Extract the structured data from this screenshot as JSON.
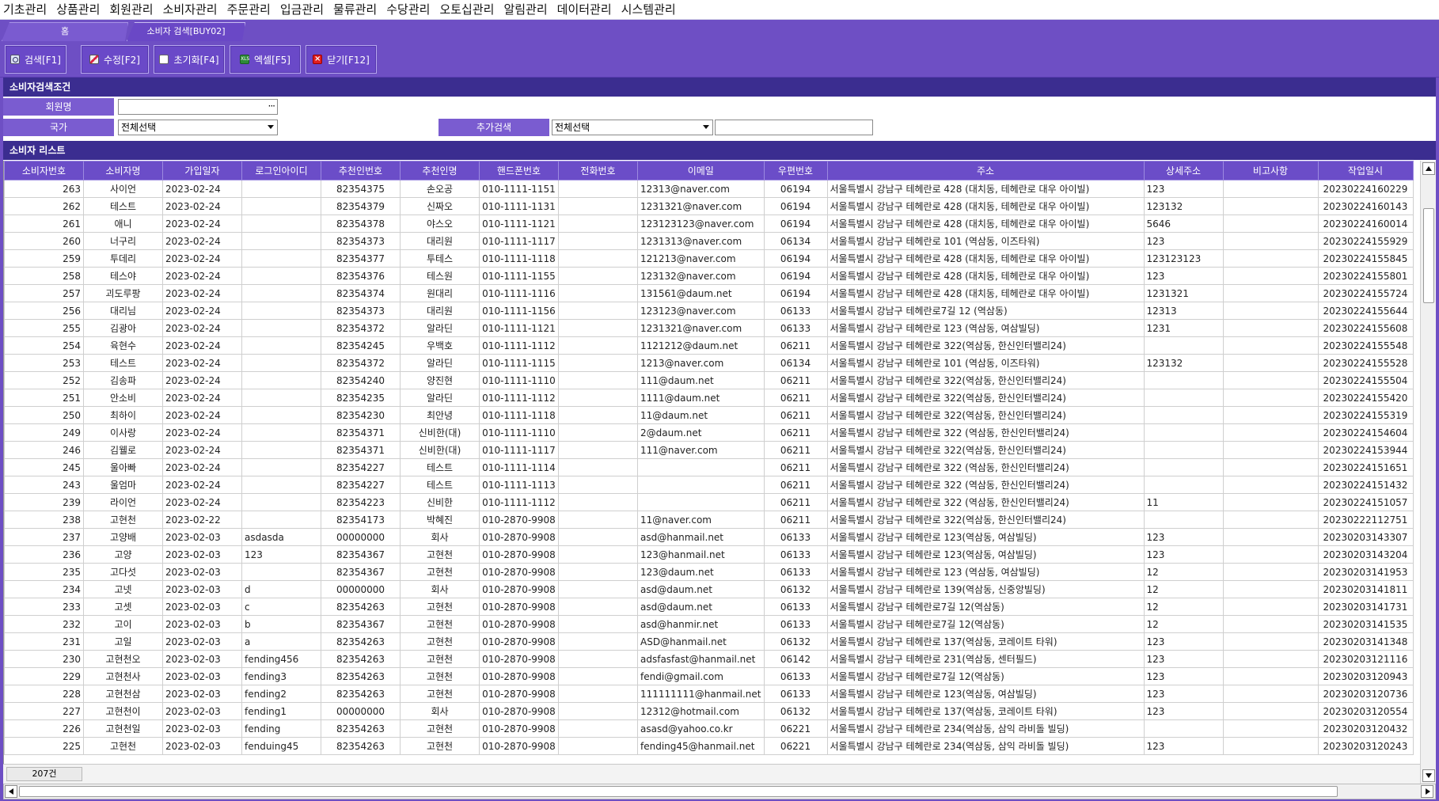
{
  "menu": [
    "기초관리",
    "상품관리",
    "회원관리",
    "소비자관리",
    "주문관리",
    "입금관리",
    "물류관리",
    "수당관리",
    "오토십관리",
    "알림관리",
    "데이터관리",
    "시스템관리"
  ],
  "tabs": {
    "home": "홈",
    "active": "소비자 검색[BUY02]"
  },
  "toolbar": {
    "search": "검색[F1]",
    "edit": "수정[F2]",
    "reset": "초기화[F4]",
    "excel": "엑셀[F5]",
    "close": "닫기[F12]",
    "excel_icon_text": "XLS"
  },
  "search_panel": {
    "title": "소비자검색조건",
    "member_label": "회원명",
    "member_value": "",
    "member_dots": "···",
    "country_label": "국가",
    "country_value": "전체선택",
    "extra_label": "추가검색",
    "extra_select_value": "전체선택",
    "extra_text_value": ""
  },
  "list": {
    "title": "소비자 리스트",
    "columns": [
      "소비자번호",
      "소비자명",
      "가입일자",
      "로그인아이디",
      "추천인번호",
      "추천인명",
      "핸드폰번호",
      "전화번호",
      "이메일",
      "우편번호",
      "주소",
      "상세주소",
      "비고사항",
      "작업일시"
    ],
    "rows": [
      [
        "263",
        "사이언",
        "2023-02-24",
        "",
        "82354375",
        "손오공",
        "010-1111-1151",
        "",
        "12313@naver.com",
        "06194",
        "서울특별시 강남구 테헤란로 428 (대치동, 테헤란로 대우 아이빌)",
        "123",
        "",
        "20230224160229"
      ],
      [
        "262",
        "테스트",
        "2023-02-24",
        "",
        "82354379",
        "신짜오",
        "010-1111-1131",
        "",
        "1231321@naver.com",
        "06194",
        "서울특별시 강남구 테헤란로 428 (대치동, 테헤란로 대우 아이빌)",
        "123132",
        "",
        "20230224160143"
      ],
      [
        "261",
        "애니",
        "2023-02-24",
        "",
        "82354378",
        "야스오",
        "010-1111-1121",
        "",
        "123123123@naver.com",
        "06194",
        "서울특별시 강남구 테헤란로 428 (대치동, 테헤란로 대우 아이빌)",
        "5646",
        "",
        "20230224160014"
      ],
      [
        "260",
        "너구리",
        "2023-02-24",
        "",
        "82354373",
        "대리원",
        "010-1111-1117",
        "",
        "1231313@naver.com",
        "06134",
        "서울특별시 강남구 테헤란로 101 (역삼동, 이즈타워)",
        "123",
        "",
        "20230224155929"
      ],
      [
        "259",
        "투데리",
        "2023-02-24",
        "",
        "82354377",
        "투테스",
        "010-1111-1118",
        "",
        "121213@naver.com",
        "06194",
        "서울특별시 강남구 테헤란로 428 (대치동, 테헤란로 대우 아이빌)",
        "123123123",
        "",
        "20230224155845"
      ],
      [
        "258",
        "테스야",
        "2023-02-24",
        "",
        "82354376",
        "테스원",
        "010-1111-1155",
        "",
        "123132@naver.com",
        "06194",
        "서울특별시 강남구 테헤란로 428 (대치동, 테헤란로 대우 아이빌)",
        "123",
        "",
        "20230224155801"
      ],
      [
        "257",
        "괴도루팡",
        "2023-02-24",
        "",
        "82354374",
        "원대리",
        "010-1111-1116",
        "",
        "131561@daum.net",
        "06194",
        "서울특별시 강남구 테헤란로 428 (대치동, 테헤란로 대우 아이빌)",
        "1231321",
        "",
        "20230224155724"
      ],
      [
        "256",
        "대리님",
        "2023-02-24",
        "",
        "82354373",
        "대리원",
        "010-1111-1156",
        "",
        "123123@naver.com",
        "06133",
        "서울특별시 강남구 테헤란로7길 12 (역삼동)",
        "12313",
        "",
        "20230224155644"
      ],
      [
        "255",
        "김광아",
        "2023-02-24",
        "",
        "82354372",
        "알라딘",
        "010-1111-1121",
        "",
        "1231321@naver.com",
        "06133",
        "서울특별시 강남구 테헤란로 123 (역삼동, 여삼빌딩)",
        "1231",
        "",
        "20230224155608"
      ],
      [
        "254",
        "육현수",
        "2023-02-24",
        "",
        "82354245",
        "우백호",
        "010-1111-1112",
        "",
        "1121212@daum.net",
        "06211",
        "서울특별시 강남구 테헤란로 322(역삼동, 한신인터밸리24)",
        "",
        "",
        "20230224155548"
      ],
      [
        "253",
        "테스트",
        "2023-02-24",
        "",
        "82354372",
        "알라딘",
        "010-1111-1115",
        "",
        "1213@naver.com",
        "06134",
        "서울특별시 강남구 테헤란로 101 (역삼동, 이즈타워)",
        "123132",
        "",
        "20230224155528"
      ],
      [
        "252",
        "김송파",
        "2023-02-24",
        "",
        "82354240",
        "양진현",
        "010-1111-1110",
        "",
        "111@daum.net",
        "06211",
        "서울특별시 강남구 테헤란로 322(역삼동, 한신인터밸리24)",
        "",
        "",
        "20230224155504"
      ],
      [
        "251",
        "안소비",
        "2023-02-24",
        "",
        "82354235",
        "알라딘",
        "010-1111-1112",
        "",
        "1111@daum.net",
        "06211",
        "서울특별시 강남구 테헤란로 322(역삼동, 한신인터밸리24)",
        "",
        "",
        "20230224155420"
      ],
      [
        "250",
        "최하이",
        "2023-02-24",
        "",
        "82354230",
        "최안녕",
        "010-1111-1118",
        "",
        "11@daum.net",
        "06211",
        "서울특별시 강남구 테헤란로 322(역삼동, 한신인터밸리24)",
        "",
        "",
        "20230224155319"
      ],
      [
        "249",
        "이사랑",
        "2023-02-24",
        "",
        "82354371",
        "신비한(대)",
        "010-1111-1110",
        "",
        "2@daum.net",
        "06211",
        "서울특별시 강남구 테헤란로 322 (역삼동, 한신인터밸리24)",
        "",
        "",
        "20230224154604"
      ],
      [
        "246",
        "김웰로",
        "2023-02-24",
        "",
        "82354371",
        "신비한(대)",
        "010-1111-1117",
        "",
        "111@naver.com",
        "06211",
        "서울특별시 강남구 테헤란로 322(역삼동, 한신인터밸리24)",
        "",
        "",
        "20230224153944"
      ],
      [
        "245",
        "울아빠",
        "2023-02-24",
        "",
        "82354227",
        "테스트",
        "010-1111-1114",
        "",
        "",
        "06211",
        "서울특별시 강남구 테헤란로 322 (역삼동, 한신인터밸리24)",
        "",
        "",
        "20230224151651"
      ],
      [
        "243",
        "울엄마",
        "2023-02-24",
        "",
        "82354227",
        "테스트",
        "010-1111-1113",
        "",
        "",
        "06211",
        "서울특별시 강남구 테헤란로 322 (역삼동, 한신인터밸리24)",
        "",
        "",
        "20230224151432"
      ],
      [
        "239",
        "라이언",
        "2023-02-24",
        "",
        "82354223",
        "신비한",
        "010-1111-1112",
        "",
        "",
        "06211",
        "서울특별시 강남구 테헤란로 322 (역삼동, 한신인터밸리24)",
        "11",
        "",
        "20230224151057"
      ],
      [
        "238",
        "고현천",
        "2023-02-22",
        "",
        "82354173",
        "박혜진",
        "010-2870-9908",
        "",
        "11@naver.com",
        "06211",
        "서울특별시 강남구 테헤란로 322(역삼동, 한신인터밸리24)",
        "",
        "",
        "20230222112751"
      ],
      [
        "237",
        "고양배",
        "2023-02-03",
        "asdasda",
        "00000000",
        "회사",
        "010-2870-9908",
        "",
        "asd@hanmail.net",
        "06133",
        "서울특별시 강남구 테헤란로 123(역삼동, 여삼빌딩)",
        "123",
        "",
        "20230203143307"
      ],
      [
        "236",
        "고양",
        "2023-02-03",
        "123",
        "82354367",
        "고현천",
        "010-2870-9908",
        "",
        "123@hanmail.net",
        "06133",
        "서울특별시 강남구 테헤란로 123(역삼동, 여삼빌딩)",
        "123",
        "",
        "20230203143204"
      ],
      [
        "235",
        "고다섯",
        "2023-02-03",
        "",
        "82354367",
        "고현천",
        "010-2870-9908",
        "",
        "123@daum.net",
        "06133",
        "서울특별시 강남구 테헤란로 123 (역삼동, 여삼빌딩)",
        "12",
        "",
        "20230203141953"
      ],
      [
        "234",
        "고넷",
        "2023-02-03",
        "d",
        "00000000",
        "회사",
        "010-2870-9908",
        "",
        "asd@daum.net",
        "06132",
        "서울특별시 강남구 테헤란로 139(역삼동, 신중앙빌딩)",
        "12",
        "",
        "20230203141811"
      ],
      [
        "233",
        "고셋",
        "2023-02-03",
        "c",
        "82354263",
        "고현천",
        "010-2870-9908",
        "",
        "asd@daum.net",
        "06133",
        "서울특별시 강남구 테헤란로7길 12(역삼동)",
        "12",
        "",
        "20230203141731"
      ],
      [
        "232",
        "고이",
        "2023-02-03",
        "b",
        "82354367",
        "고현천",
        "010-2870-9908",
        "",
        "asd@hanmir.net",
        "06133",
        "서울특별시 강남구 테헤란로7길 12(역삼동)",
        "12",
        "",
        "20230203141535"
      ],
      [
        "231",
        "고일",
        "2023-02-03",
        "a",
        "82354263",
        "고현천",
        "010-2870-9908",
        "",
        "ASD@hanmail.net",
        "06132",
        "서울특별시 강남구 테헤란로 137(역삼동, 코레이트 타워)",
        "123",
        "",
        "20230203141348"
      ],
      [
        "230",
        "고현천오",
        "2023-02-03",
        "fending456",
        "82354263",
        "고현천",
        "010-2870-9908",
        "",
        "adsfasfast@hanmail.net",
        "06142",
        "서울특별시 강남구 테헤란로 231(역삼동, 센터필드)",
        "123",
        "",
        "20230203121116"
      ],
      [
        "229",
        "고현천사",
        "2023-02-03",
        "fending3",
        "82354263",
        "고현천",
        "010-2870-9908",
        "",
        "fendi@gmail.com",
        "06133",
        "서울특별시 강남구 테헤란로7길 12(역삼동)",
        "123",
        "",
        "20230203120943"
      ],
      [
        "228",
        "고현천삼",
        "2023-02-03",
        "fending2",
        "82354263",
        "고현천",
        "010-2870-9908",
        "",
        "111111111@hanmail.net",
        "06133",
        "서울특별시 강남구 테헤란로 123(역삼동, 여삼빌딩)",
        "123",
        "",
        "20230203120736"
      ],
      [
        "227",
        "고현천이",
        "2023-02-03",
        "fending1",
        "00000000",
        "회사",
        "010-2870-9908",
        "",
        "12312@hotmail.com",
        "06132",
        "서울특별시 강남구 테헤란로 137(역삼동, 코레이트 타워)",
        "123",
        "",
        "20230203120554"
      ],
      [
        "226",
        "고현천일",
        "2023-02-03",
        "fending",
        "82354263",
        "고현천",
        "010-2870-9908",
        "",
        "asasd@yahoo.co.kr",
        "06221",
        "서울특별시 강남구 테헤란로 234(역삼동, 삼익 라비돌 빌딩)",
        "",
        "",
        "20230203120432"
      ],
      [
        "225",
        "고현천",
        "2023-02-03",
        "fenduing45",
        "82354263",
        "고현천",
        "010-2870-9908",
        "",
        "fending45@hanmail.net",
        "06221",
        "서울특별시 강남구 테헤란로 234(역삼동, 삼익 라비돌 빌딩)",
        "123",
        "",
        "20230203120243"
      ]
    ]
  },
  "status": {
    "count": "207건"
  },
  "colors": {
    "accent": "#6e4fc4",
    "header_bg": "#6b4dc8",
    "section_bg": "#3b2d90"
  }
}
